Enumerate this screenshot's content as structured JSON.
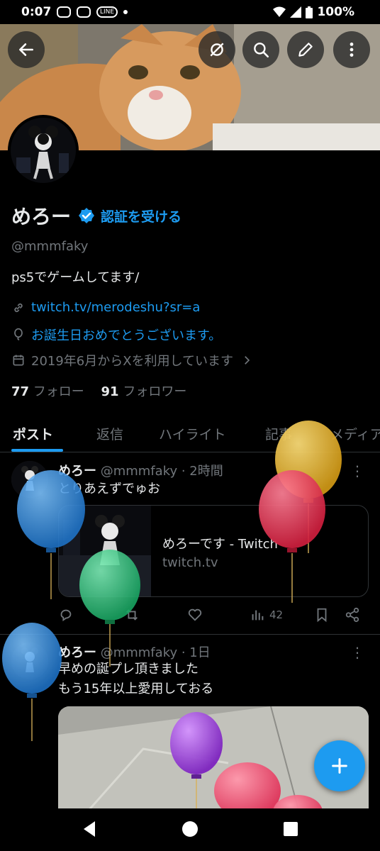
{
  "status": {
    "time": "0:07",
    "line_label": "LINE",
    "battery": "100%"
  },
  "profile": {
    "name": "めろー",
    "verify_label": "認証を受ける",
    "handle": "@mmmfaky",
    "bio": "ps5でゲームしてます/",
    "link": "twitch.tv/merodeshu?sr=a",
    "birthday": "お誕生日おめでとうございます。",
    "joined": "2019年6月からXを利用しています",
    "following_count": "77",
    "following_label": "フォロー",
    "followers_count": "91",
    "followers_label": "フォロワー"
  },
  "tabs": [
    "ポスト",
    "返信",
    "ハイライト",
    "記事",
    "メディア"
  ],
  "posts": [
    {
      "name": "めろー",
      "meta": "@mmmfaky · 2時間",
      "text_lines": [
        "とりあえずでゅお"
      ],
      "card_title": "めろーです - Twitch",
      "card_domain": "twitch.tv",
      "views": "42"
    },
    {
      "name": "めろー",
      "meta": "@mmmfaky · 1日",
      "text_lines": [
        "早めの誕プレ頂きました",
        "もう15年以上愛用しておる"
      ]
    }
  ],
  "colors": {
    "accent": "#1d9bf0",
    "balloon_blue": "#2f8fe0",
    "balloon_green": "#2ecf84",
    "balloon_yellow": "#e6b32a",
    "balloon_red": "#e8304e",
    "balloon_purple": "#9b3fd8",
    "balloon_pink": "#ef4a6a"
  }
}
